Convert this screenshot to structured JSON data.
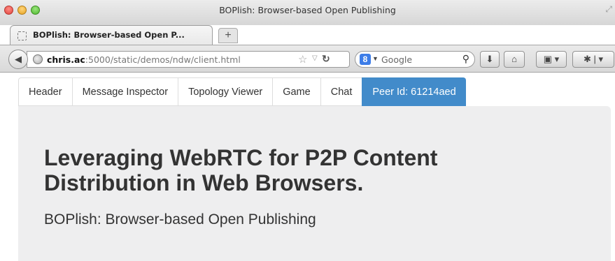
{
  "window": {
    "title": "BOPlish: Browser-based Open Publishing"
  },
  "browser": {
    "tab_label": "BOPlish: Browser-based Open P...",
    "new_tab_symbol": "+",
    "url_host": "chris.ac",
    "url_rest": ":5000/static/demos/ndw/client.html",
    "search_placeholder": "Google",
    "search_engine_badge": "8",
    "icons": [
      "back-arrow-icon",
      "globe-icon",
      "star-icon",
      "reload-icon",
      "search-icon",
      "download-icon",
      "home-icon",
      "screenshot-icon",
      "firebug-icon"
    ]
  },
  "page": {
    "nav_tabs": [
      "Header",
      "Message Inspector",
      "Topology Viewer",
      "Game",
      "Chat",
      "Peer Id: 61214aed"
    ],
    "active_tab_index": 5,
    "title_line1": "Leveraging WebRTC for P2P Content",
    "title_line2": "Distribution in Web Browsers.",
    "subtitle": "BOPlish: Browser-based Open Publishing"
  },
  "colors": {
    "active_tab": "#428bca",
    "jumbotron_bg": "#eeeeef"
  }
}
